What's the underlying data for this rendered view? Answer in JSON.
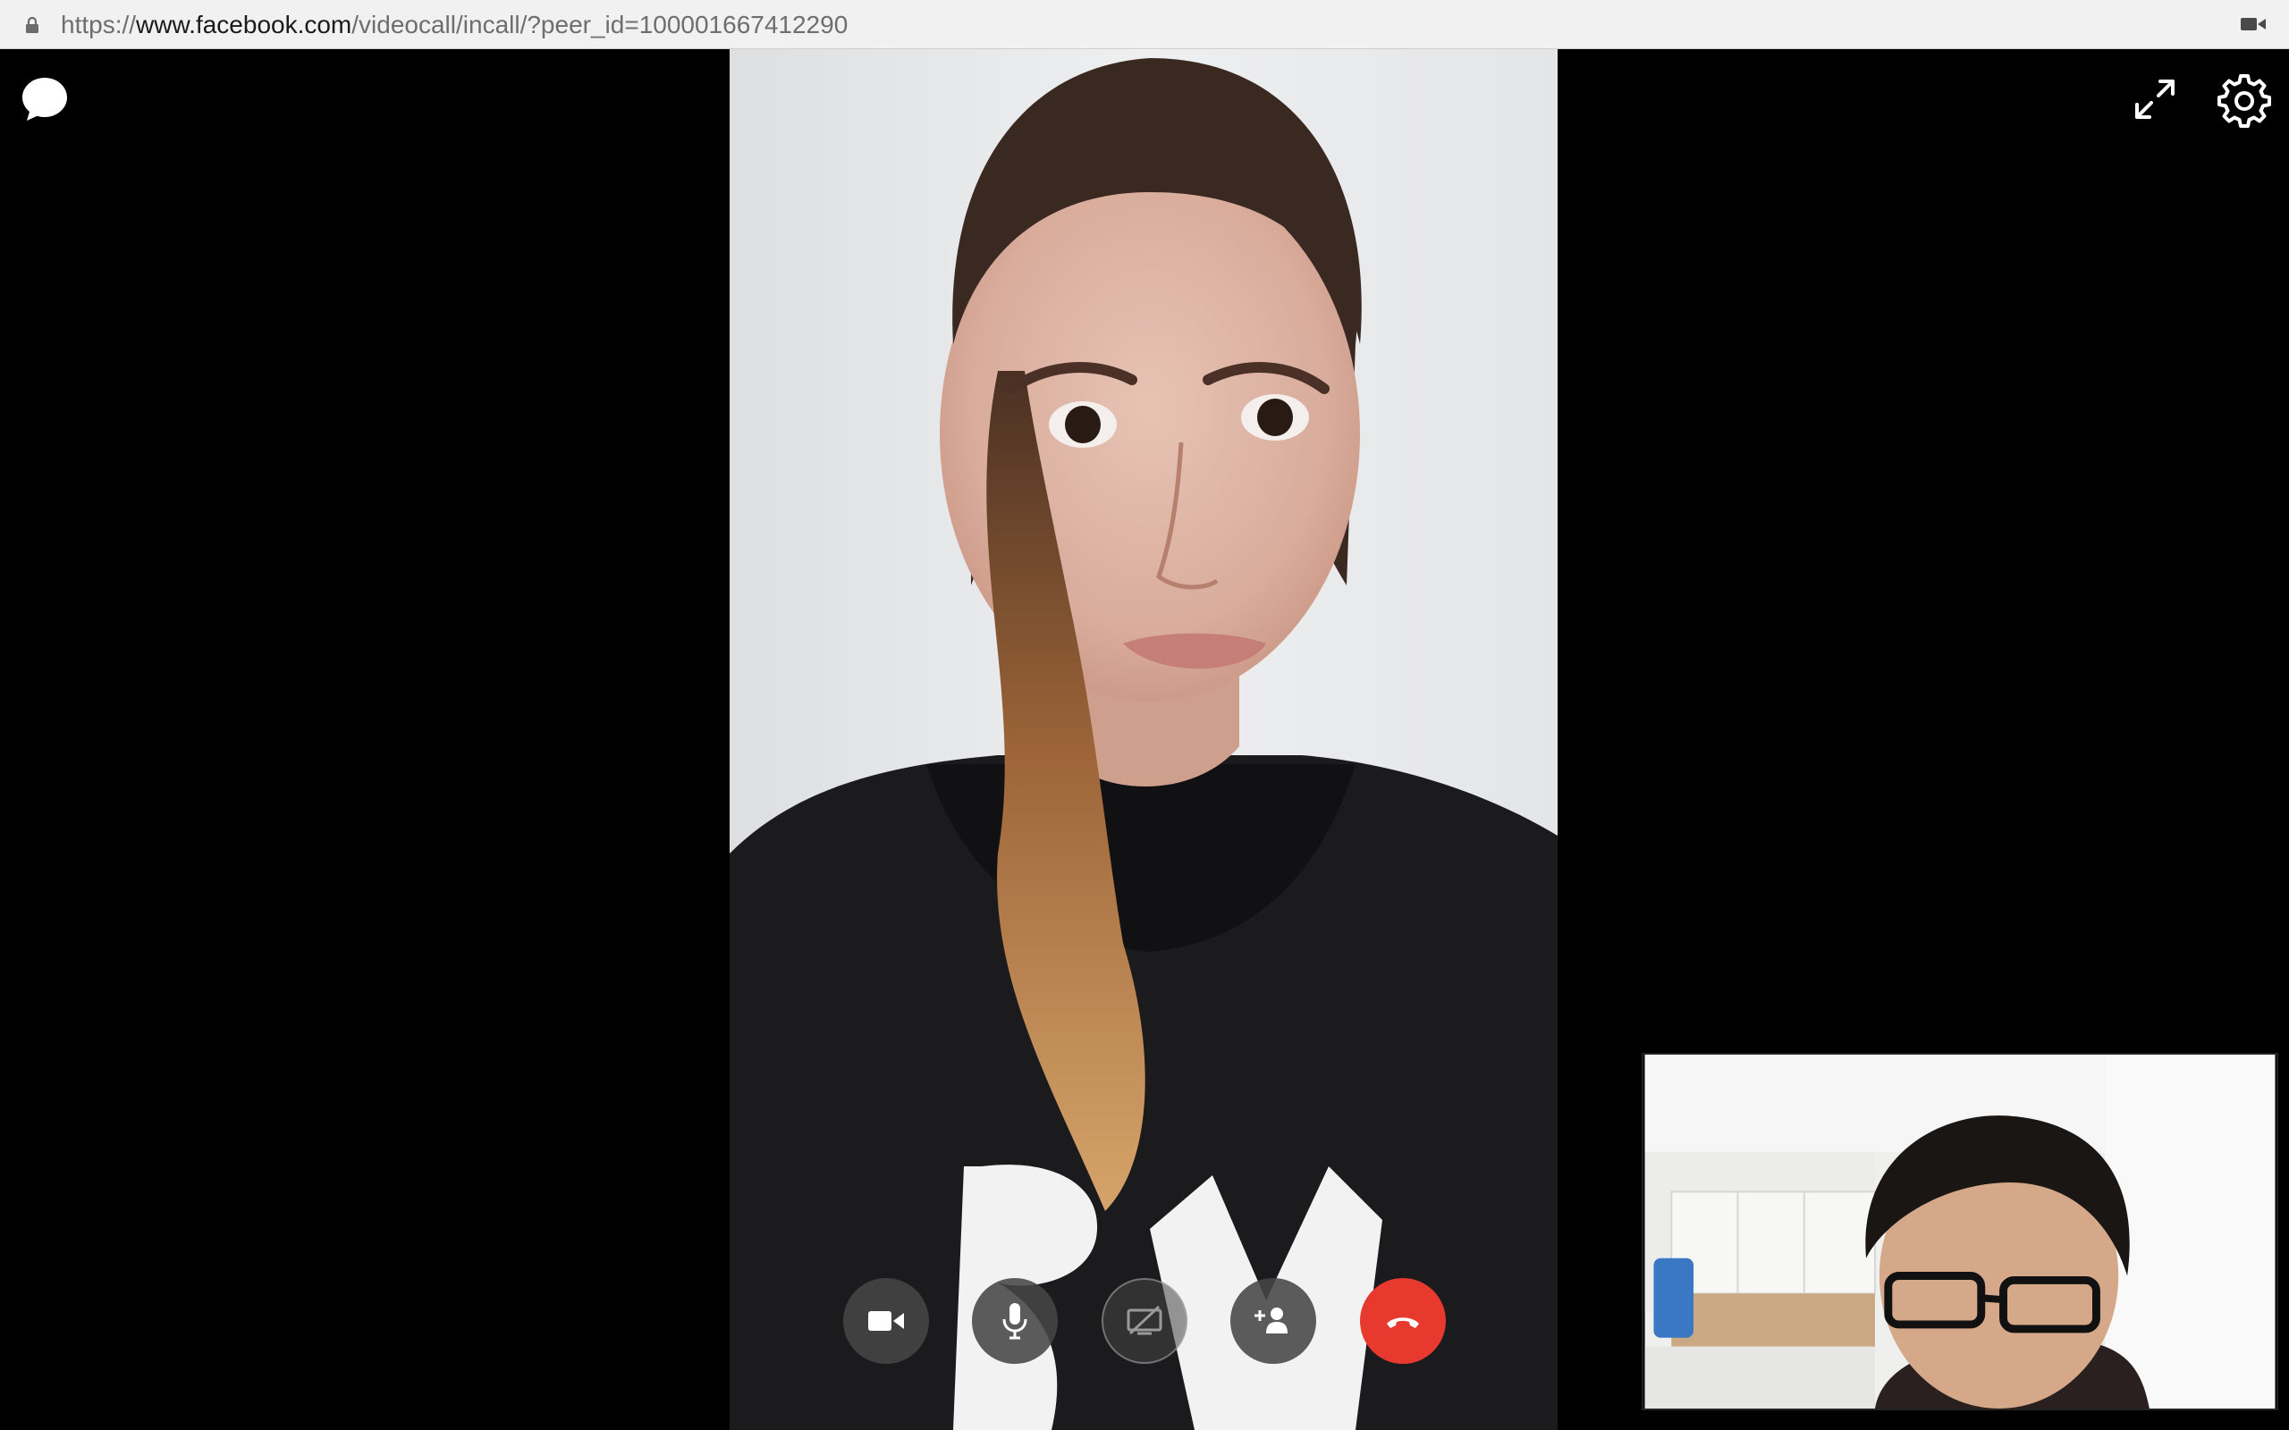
{
  "address_bar": {
    "url_prefix": "https://",
    "url_host": "www.facebook.com",
    "url_path": "/videocall/incall/?peer_id=100001667412290"
  },
  "icons": {
    "lock": "lock-icon",
    "camera_indicator": "video-camera-icon",
    "chat": "chat-bubble-icon",
    "fullscreen": "expand-arrows-icon",
    "settings": "gear-icon"
  },
  "controls": [
    {
      "name": "toggle-camera",
      "icon": "video-camera-icon"
    },
    {
      "name": "toggle-microphone",
      "icon": "microphone-icon"
    },
    {
      "name": "screen-share",
      "icon": "screen-share-off-icon",
      "state": "disabled"
    },
    {
      "name": "add-person",
      "icon": "add-person-icon"
    },
    {
      "name": "end-call",
      "icon": "phone-hangup-icon",
      "color": "#e8392f"
    }
  ],
  "colors": {
    "end_call": "#e8392f",
    "control_bg": "#464646",
    "address_bar_bg": "#f1f1f1"
  }
}
